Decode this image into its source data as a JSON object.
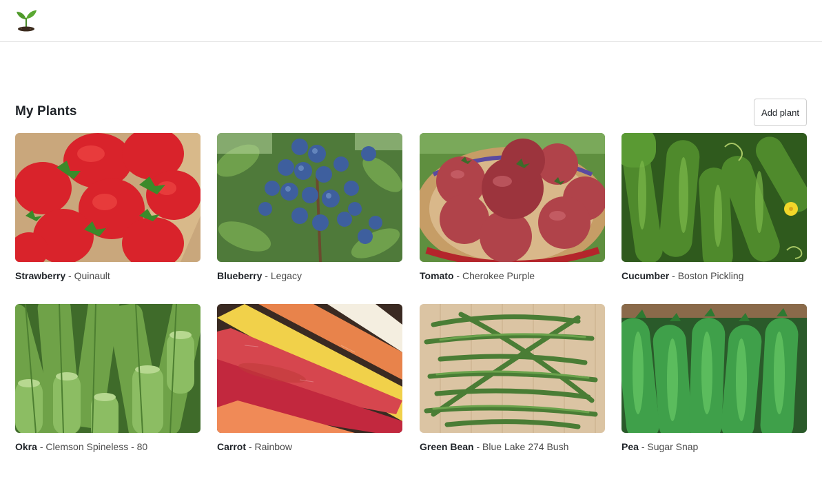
{
  "header": {
    "logo_icon": "seedling-icon"
  },
  "main": {
    "title": "My Plants",
    "add_button_label": "Add plant"
  },
  "plants": [
    {
      "name": "Strawberry",
      "separator": "-",
      "variety": "Quinault",
      "image": "strawberry-photo"
    },
    {
      "name": "Blueberry",
      "separator": "-",
      "variety": "Legacy",
      "image": "blueberry-photo"
    },
    {
      "name": "Tomato",
      "separator": "-",
      "variety": "Cherokee Purple",
      "image": "tomato-photo"
    },
    {
      "name": "Cucumber",
      "separator": "-",
      "variety": "Boston Pickling",
      "image": "cucumber-photo"
    },
    {
      "name": "Okra",
      "separator": "-",
      "variety": "Clemson Spineless - 80",
      "image": "okra-photo"
    },
    {
      "name": "Carrot",
      "separator": "-",
      "variety": "Rainbow",
      "image": "carrot-photo"
    },
    {
      "name": "Green Bean",
      "separator": "-",
      "variety": "Blue Lake 274 Bush",
      "image": "green-bean-photo"
    },
    {
      "name": "Pea",
      "separator": "-",
      "variety": "Sugar Snap",
      "image": "pea-photo"
    }
  ]
}
